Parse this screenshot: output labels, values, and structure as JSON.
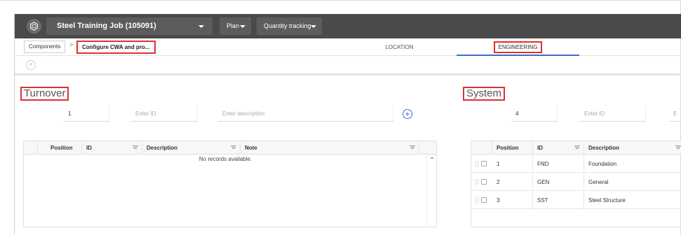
{
  "header": {
    "project": "Steel Training Job (105091)",
    "menus": [
      "Plan",
      "Quantity tracking"
    ]
  },
  "breadcrumb": {
    "root": "Components",
    "separator": ">",
    "current": "Configure CWA and pro..."
  },
  "tabs": [
    "LOCATION",
    "ENGINEERING"
  ],
  "turnover": {
    "title": "Turnover",
    "position_value": "1",
    "id_placeholder": "Enter ID",
    "description_placeholder": "Enter description",
    "columns": [
      "Position",
      "ID",
      "Description",
      "Note"
    ],
    "empty_text": "No records available."
  },
  "system": {
    "title": "System",
    "position_value": "4",
    "id_placeholder": "Enter ID",
    "description_placeholder_partial": "E",
    "columns": [
      "Position",
      "ID",
      "Description"
    ],
    "rows": [
      {
        "position": "1",
        "id": "FND",
        "description": "Foundation"
      },
      {
        "position": "2",
        "id": "GEN",
        "description": "General"
      },
      {
        "position": "3",
        "id": "SST",
        "description": "Steel Structure"
      }
    ]
  },
  "colors": {
    "topbar": "#4a4a4a",
    "highlight": "#e03030",
    "accent": "#3a6fc4"
  }
}
